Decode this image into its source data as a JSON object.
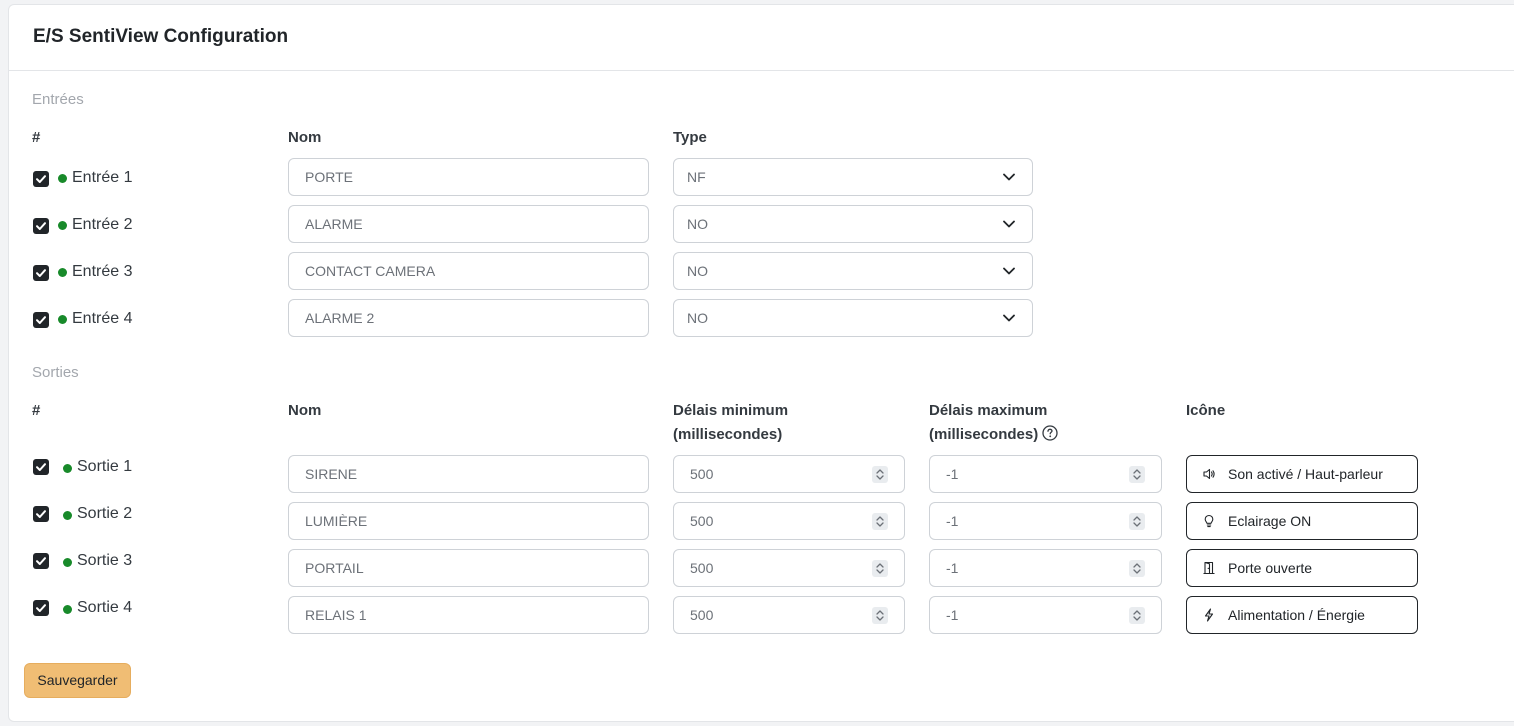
{
  "header": {
    "title": "E/S SentiView Configuration"
  },
  "inputs": {
    "section_label": "Entrées",
    "col_hash": "#",
    "col_name": "Nom",
    "col_type": "Type",
    "rows": [
      {
        "checked": true,
        "label": "Entrée 1",
        "name": "PORTE",
        "type": "NF"
      },
      {
        "checked": true,
        "label": "Entrée 2",
        "name": "ALARME",
        "type": "NO"
      },
      {
        "checked": true,
        "label": "Entrée 3",
        "name": "CONTACT CAMERA",
        "type": "NO"
      },
      {
        "checked": true,
        "label": "Entrée 4",
        "name": "ALARME 2",
        "type": "NO"
      }
    ]
  },
  "outputs": {
    "section_label": "Sorties",
    "col_hash": "#",
    "col_name": "Nom",
    "col_min_line1": "Délais minimum",
    "col_min_line2": "(millisecondes)",
    "col_max_line1": "Délais maximum",
    "col_max_line2": "(millisecondes)",
    "col_icon": "Icône",
    "rows": [
      {
        "checked": true,
        "label": "Sortie 1",
        "name": "SIRENE",
        "min": "500",
        "max": "-1",
        "icon_label": "Son activé / Haut-parleur",
        "icon": "speaker-icon"
      },
      {
        "checked": true,
        "label": "Sortie 2",
        "name": "LUMIÈRE",
        "min": "500",
        "max": "-1",
        "icon_label": "Eclairage ON",
        "icon": "lightbulb-icon"
      },
      {
        "checked": true,
        "label": "Sortie 3",
        "name": "PORTAIL",
        "min": "500",
        "max": "-1",
        "icon_label": "Porte ouverte",
        "icon": "door-open-icon"
      },
      {
        "checked": true,
        "label": "Sortie 4",
        "name": "RELAIS 1",
        "min": "500",
        "max": "-1",
        "icon_label": "Alimentation / Énergie",
        "icon": "lightning-icon"
      }
    ]
  },
  "actions": {
    "save_label": "Sauvegarder"
  },
  "colors": {
    "status_dot": "#188a2a",
    "save_button": "#f0bd74",
    "checkbox": "#212529"
  }
}
